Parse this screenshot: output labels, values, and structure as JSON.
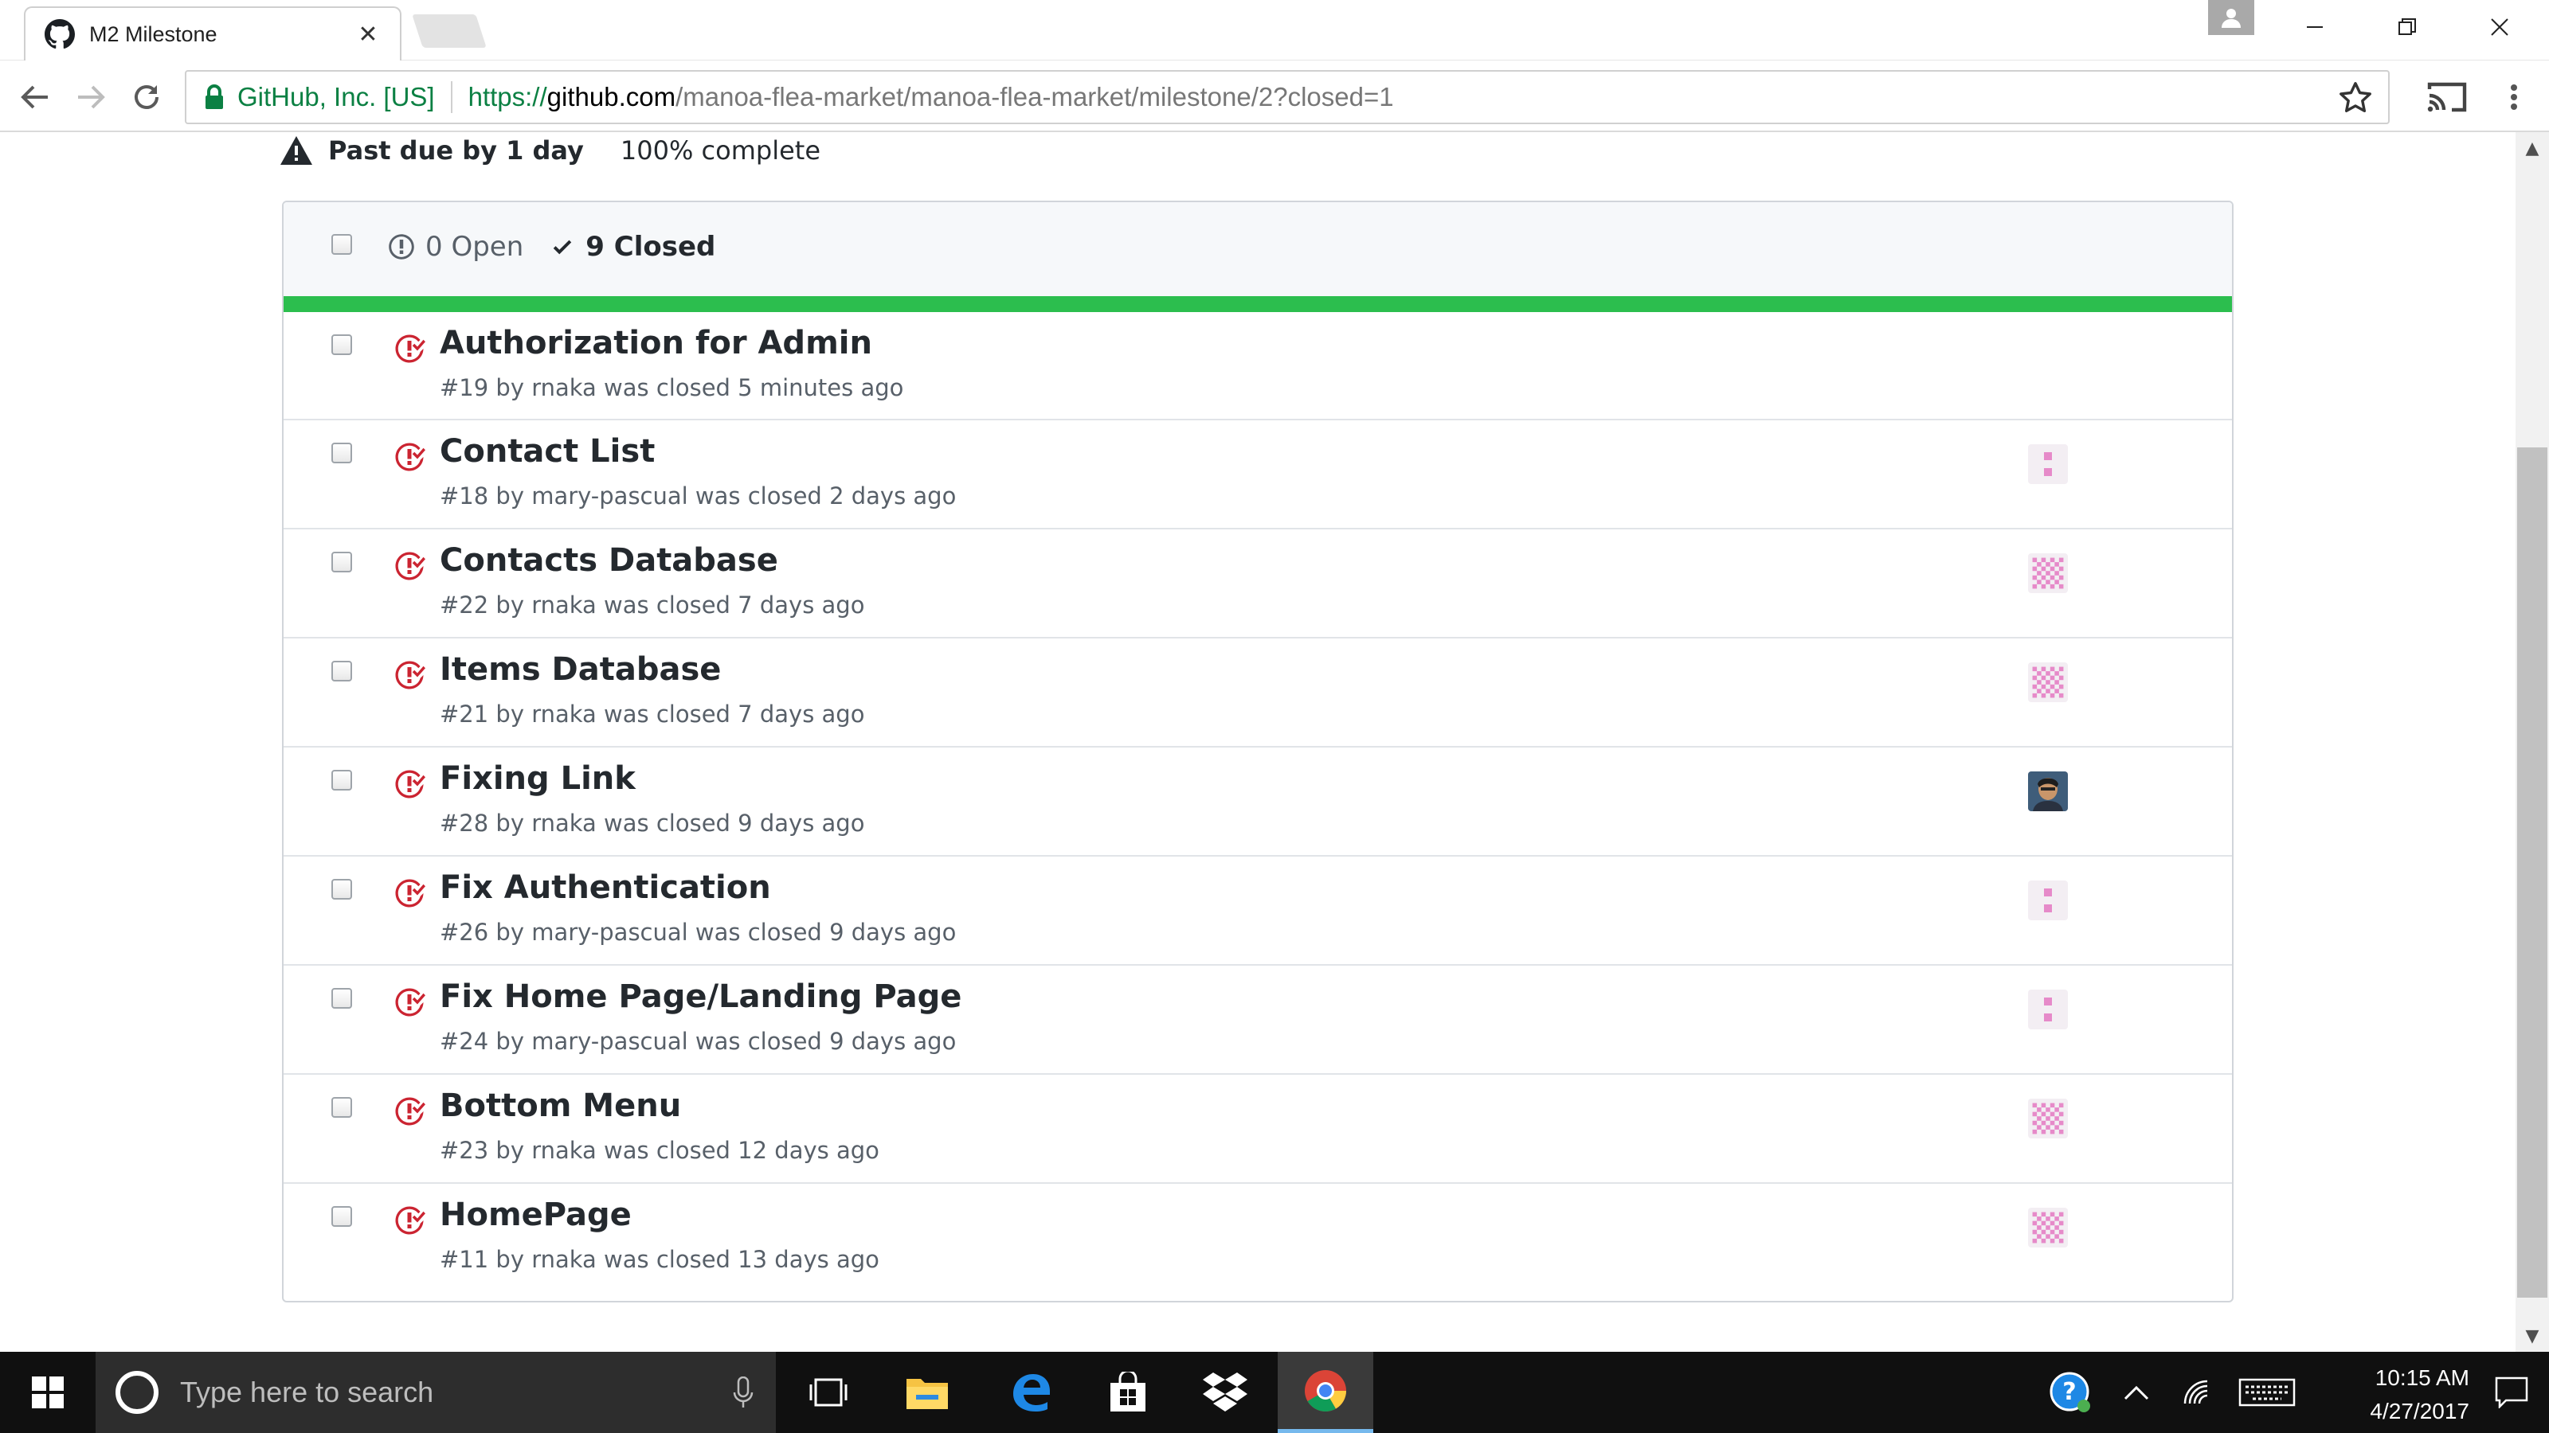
{
  "browser": {
    "tab_title": "M2 Milestone",
    "site_identity": "GitHub, Inc. [US]",
    "url_scheme": "https://",
    "url_host": "github.com",
    "url_path": "/manoa-flea-market/manoa-flea-market/milestone/2?closed=1"
  },
  "milestone": {
    "past_due": "Past due by 1 day",
    "complete": "100% complete",
    "progress_fraction": 1.0,
    "open_label": "0 Open",
    "closed_label": "9 Closed"
  },
  "issues": [
    {
      "title": "Authorization for Admin",
      "meta": "#19 by rnaka was closed 5 minutes ago",
      "avatar": "none"
    },
    {
      "title": "Contact List",
      "meta": "#18 by mary-pascual was closed 2 days ago",
      "avatar": "identicon-dots"
    },
    {
      "title": "Contacts Database",
      "meta": "#22 by rnaka was closed 7 days ago",
      "avatar": "identicon-pattern"
    },
    {
      "title": "Items Database",
      "meta": "#21 by rnaka was closed 7 days ago",
      "avatar": "identicon-pattern"
    },
    {
      "title": "Fixing Link",
      "meta": "#28 by rnaka was closed 9 days ago",
      "avatar": "photo"
    },
    {
      "title": "Fix Authentication",
      "meta": "#26 by mary-pascual was closed 9 days ago",
      "avatar": "identicon-dots"
    },
    {
      "title": "Fix Home Page/Landing Page",
      "meta": "#24 by mary-pascual was closed 9 days ago",
      "avatar": "identicon-dots"
    },
    {
      "title": "Bottom Menu",
      "meta": "#23 by rnaka was closed 12 days ago",
      "avatar": "identicon-pattern"
    },
    {
      "title": "HomePage",
      "meta": "#11 by rnaka was closed 13 days ago",
      "avatar": "identicon-pattern"
    }
  ],
  "taskbar": {
    "search_placeholder": "Type here to search",
    "time": "10:15 AM",
    "date": "4/27/2017"
  },
  "colors": {
    "closed_issue_red": "#cb2431",
    "progress_green": "#2cbe4e",
    "secure_green": "#0b8043",
    "identicon_pink": "#e68ac9"
  }
}
